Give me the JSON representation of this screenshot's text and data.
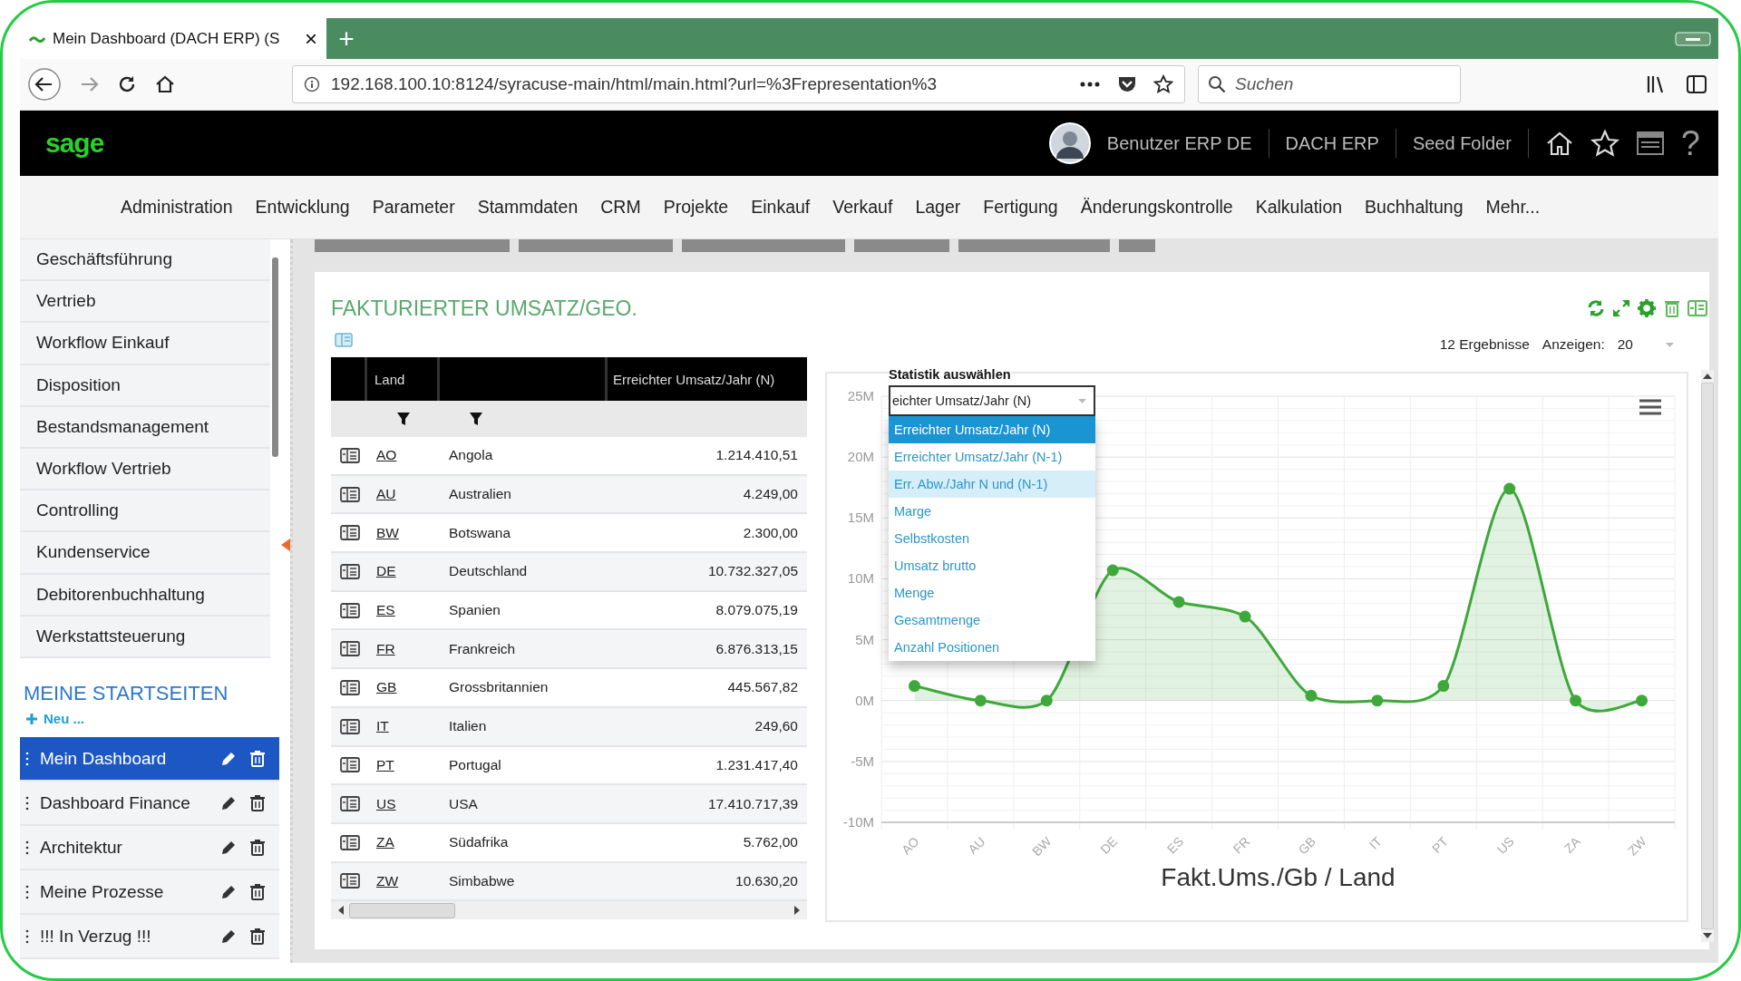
{
  "browser": {
    "tab": {
      "title": "Mein Dashboard (DACH ERP) (S",
      "close": "×"
    },
    "new_tab": "+",
    "url": "192.168.100.10:8124/syracuse-main/html/main.html?url=%3Frepresentation%3",
    "search": {
      "placeholder": "Suchen"
    }
  },
  "header": {
    "logo": "sage",
    "user": "Benutzer ERP DE",
    "links": [
      "DACH ERP",
      "Seed Folder"
    ],
    "help": "?"
  },
  "menu": [
    "Administration",
    "Entwicklung",
    "Parameter",
    "Stammdaten",
    "CRM",
    "Projekte",
    "Einkauf",
    "Verkauf",
    "Lager",
    "Fertigung",
    "Änderungskontrolle",
    "Kalkulation",
    "Buchhaltung",
    "Mehr..."
  ],
  "sidebar": {
    "items": [
      "Geschäftsführung",
      "Vertrieb",
      "Workflow Einkauf",
      "Disposition",
      "Bestandsmanagement",
      "Workflow Vertrieb",
      "Controlling",
      "Kundenservice",
      "Debitorenbuchhaltung",
      "Werkstattsteuerung"
    ],
    "startpages": {
      "title": "MEINE STARTSEITEN",
      "new": "Neu ...",
      "items": [
        {
          "label": "Mein Dashboard",
          "selected": true
        },
        {
          "label": "Dashboard Finance",
          "selected": false
        },
        {
          "label": "Architektur",
          "selected": false
        },
        {
          "label": "Meine Prozesse",
          "selected": false
        },
        {
          "label": "!!! In Verzug !!!",
          "selected": false
        }
      ]
    }
  },
  "panel": {
    "title": "FAKTURIERTER UMSATZ/GEO.",
    "results": "12 Ergebnisse",
    "show_label": "Anzeigen:",
    "show_value": "20",
    "table": {
      "columns": [
        {
          "kind": "icon"
        },
        {
          "kind": "code",
          "label": "Land",
          "filter": true
        },
        {
          "kind": "name",
          "filter": true
        },
        {
          "kind": "number",
          "label": "Erreichter Umsatz/Jahr (N)"
        }
      ],
      "rows": [
        {
          "code": "AO",
          "name": "Angola",
          "value": "1.214.410,51"
        },
        {
          "code": "AU",
          "name": "Australien",
          "value": "4.249,00"
        },
        {
          "code": "BW",
          "name": "Botswana",
          "value": "2.300,00"
        },
        {
          "code": "DE",
          "name": "Deutschland",
          "value": "10.732.327,05"
        },
        {
          "code": "ES",
          "name": "Spanien",
          "value": "8.079.075,19"
        },
        {
          "code": "FR",
          "name": "Frankreich",
          "value": "6.876.313,15"
        },
        {
          "code": "GB",
          "name": "Grossbritannien",
          "value": "445.567,82"
        },
        {
          "code": "IT",
          "name": "Italien",
          "value": "249,60"
        },
        {
          "code": "PT",
          "name": "Portugal",
          "value": "1.231.417,40"
        },
        {
          "code": "US",
          "name": "USA",
          "value": "17.410.717,39"
        },
        {
          "code": "ZA",
          "name": "Südafrika",
          "value": "5.762,00"
        },
        {
          "code": "ZW",
          "name": "Simbabwe",
          "value": "10.630,20"
        }
      ]
    },
    "statistic": {
      "label": "Statistik auswählen",
      "value": "eichter Umsatz/Jahr (N)",
      "options": [
        {
          "label": "Erreichter Umsatz/Jahr (N)",
          "selected": true,
          "hovered": false
        },
        {
          "label": "Erreichter Umsatz/Jahr (N-1)",
          "selected": false,
          "hovered": false
        },
        {
          "label": "Err. Abw./Jahr N und (N-1)",
          "selected": false,
          "hovered": true
        },
        {
          "label": "Marge",
          "selected": false,
          "hovered": false
        },
        {
          "label": "Selbstkosten",
          "selected": false,
          "hovered": false
        },
        {
          "label": "Umsatz brutto",
          "selected": false,
          "hovered": false
        },
        {
          "label": "Menge",
          "selected": false,
          "hovered": false
        },
        {
          "label": "Gesamtmenge",
          "selected": false,
          "hovered": false
        },
        {
          "label": "Anzahl Positionen",
          "selected": false,
          "hovered": false
        }
      ]
    },
    "chart_data": {
      "type": "area",
      "xlabel": "Fakt.Ums./Gb / Land",
      "categories": [
        "AO",
        "AU",
        "BW",
        "DE",
        "ES",
        "FR",
        "GB",
        "IT",
        "PT",
        "US",
        "ZA",
        "ZW"
      ],
      "series": [
        {
          "color": "#3ea83a",
          "values": [
            1.2,
            0,
            0,
            10.7,
            8.1,
            6.9,
            0.4,
            0,
            1.2,
            17.4,
            0,
            0
          ]
        }
      ],
      "grid": true,
      "ylim": [
        -10,
        25
      ],
      "yticks": [
        {
          "value": 25,
          "label": "25M"
        },
        {
          "value": 20,
          "label": "20M"
        },
        {
          "value": 15,
          "label": "15M"
        },
        {
          "value": 10,
          "label": "10M"
        },
        {
          "value": 5,
          "label": "5M"
        },
        {
          "value": 0,
          "label": "0M"
        },
        {
          "value": -5,
          "label": "-5M"
        },
        {
          "value": -10,
          "label": "-10M"
        }
      ]
    }
  }
}
